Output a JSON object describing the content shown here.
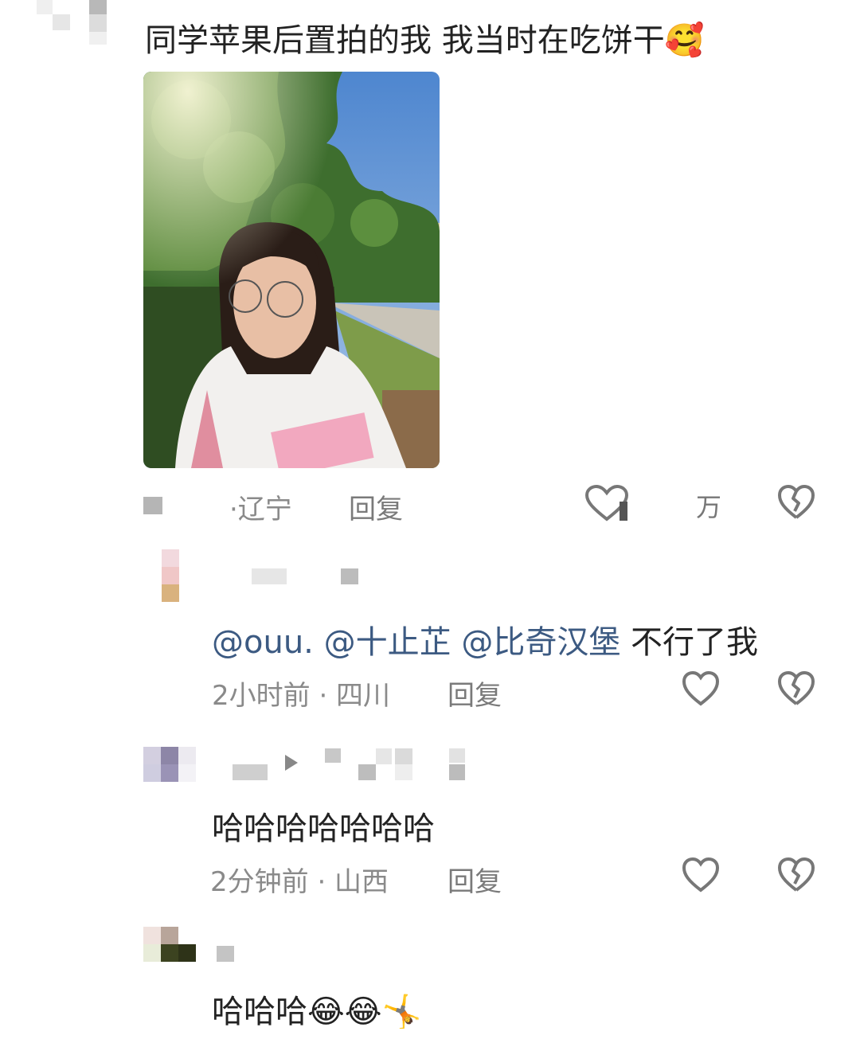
{
  "post": {
    "text": "同学苹果后置拍的我 我当时在吃饼干",
    "emoji": "🥰",
    "photo_label": "",
    "meta": {
      "location": "·辽宁",
      "reply": "回复",
      "like_count": "万"
    }
  },
  "replies": [
    {
      "mentions": [
        "@ouu.",
        "@十止芷",
        "@比奇汉堡"
      ],
      "text": "不行了我",
      "meta": "2小时前 · 四川",
      "reply": "回复"
    },
    {
      "text": "哈哈哈哈哈哈哈",
      "meta": "2分钟前 · 山西",
      "reply": "回复"
    },
    {
      "text": "哈哈哈",
      "emojis": [
        "😂",
        "😂",
        "🤸"
      ]
    }
  ],
  "icons": {
    "like": "heart-outline-icon",
    "dislike": "broken-heart-icon"
  }
}
